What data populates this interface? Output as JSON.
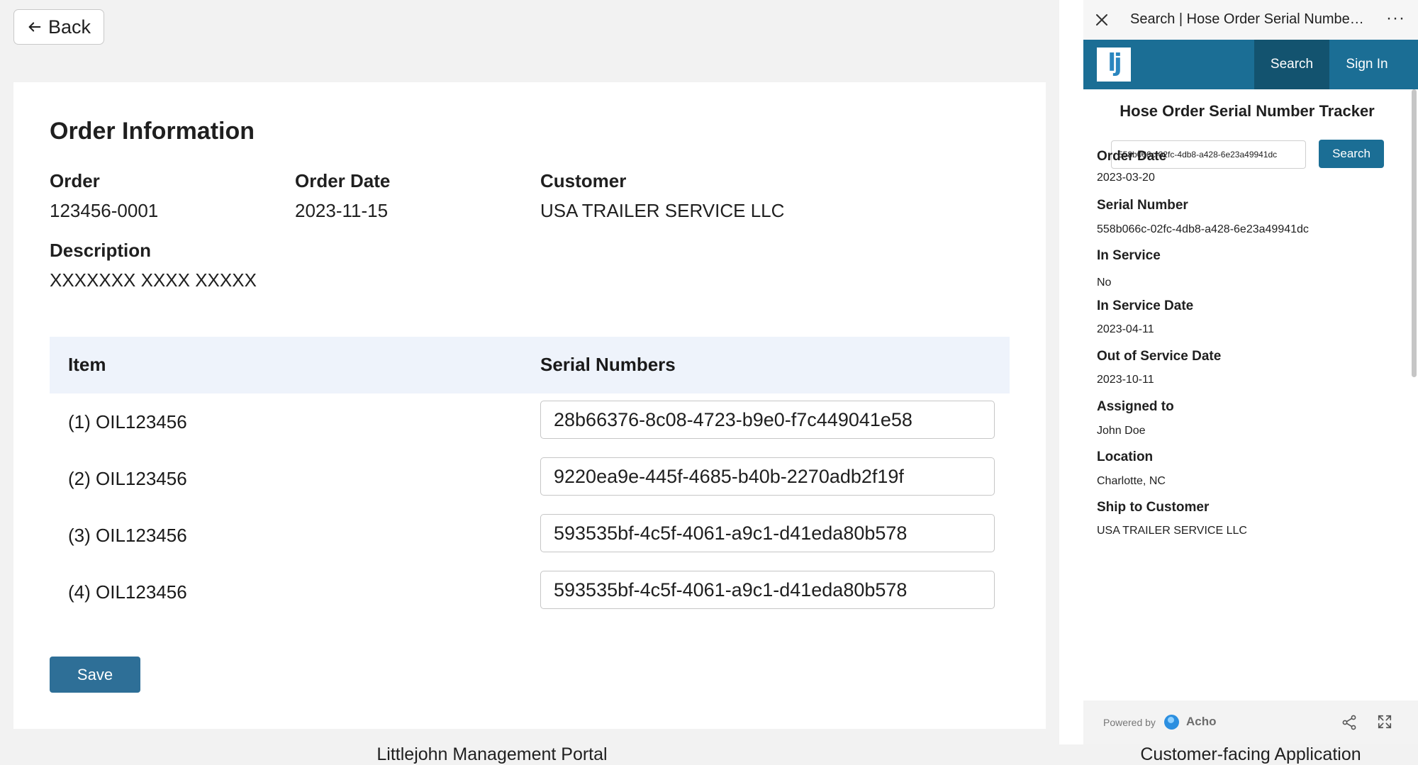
{
  "portal": {
    "back_label": "Back",
    "title": "Order Information",
    "fields": {
      "order_label": "Order",
      "order_value": "123456-0001",
      "order_date_label": "Order Date",
      "order_date_value": "2023-11-15",
      "customer_label": "Customer",
      "customer_value": "USA TRAILER SERVICE LLC",
      "description_label": "Description",
      "description_value": "XXXXXXX XXXX XXXXX"
    },
    "table": {
      "headers": [
        "Item",
        "Serial Numbers"
      ],
      "rows": [
        {
          "item": "(1) OIL123456",
          "serial": "28b66376-8c08-4723-b9e0-f7c449041e58"
        },
        {
          "item": "(2) OIL123456",
          "serial": "9220ea9e-445f-4685-b40b-2270adb2f19f"
        },
        {
          "item": "(3) OIL123456",
          "serial": "593535bf-4c5f-4061-a9c1-d41eda80b578"
        },
        {
          "item": "(4) OIL123456",
          "serial": "593535bf-4c5f-4061-a9c1-d41eda80b578"
        }
      ]
    },
    "save_label": "Save",
    "accent": "#2e6f97"
  },
  "app": {
    "window_title": "Search | Hose Order Serial Number...",
    "more_glyph": "···",
    "logo_text": "lj",
    "nav": {
      "search": "Search",
      "sign_in": "Sign In"
    },
    "tracker_title": "Hose Order Serial Number Tracker",
    "search_value": "558b066c-02fc-4db8-a428-6e23a49941dc",
    "search_button": "Search",
    "details": [
      {
        "label": "Order Date",
        "value": "2023-03-20"
      },
      {
        "label": "Serial Number",
        "value": "558b066c-02fc-4db8-a428-6e23a49941dc"
      },
      {
        "label": "In Service",
        "value": "No"
      },
      {
        "label": "In Service Date",
        "value": "2023-04-11"
      },
      {
        "label": "Out of Service Date",
        "value": "2023-10-11"
      },
      {
        "label": "Assigned to",
        "value": "John Doe"
      },
      {
        "label": "Location",
        "value": "Charlotte, NC"
      },
      {
        "label": "Ship to Customer",
        "value": "USA TRAILER SERVICE LLC"
      }
    ],
    "footer": {
      "powered_by": "Powered by",
      "brand": "Acho"
    },
    "nav_color": "#1b6e95"
  },
  "captions": {
    "left": "Littlejohn Management Portal",
    "right": "Customer-facing Application"
  }
}
